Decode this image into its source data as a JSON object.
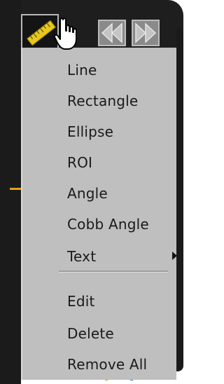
{
  "toolbar": {
    "active_tool_icon": "ruler-icon",
    "nav_buttons": [
      "previous-icon",
      "next-icon"
    ]
  },
  "menu": {
    "items": [
      {
        "label": "Line"
      },
      {
        "label": "Rectangle"
      },
      {
        "label": "Ellipse"
      },
      {
        "label": "ROI"
      },
      {
        "label": "Angle"
      },
      {
        "label": "Cobb Angle"
      },
      {
        "label": "Text",
        "submenu": true
      }
    ],
    "actions": [
      {
        "label": "Edit"
      },
      {
        "label": "Delete"
      },
      {
        "label": "Remove All"
      }
    ]
  },
  "colors": {
    "menu_background": "#bfbfbf",
    "toolbar_background": "#1e1e1e",
    "ruler": "#e8c81a"
  }
}
